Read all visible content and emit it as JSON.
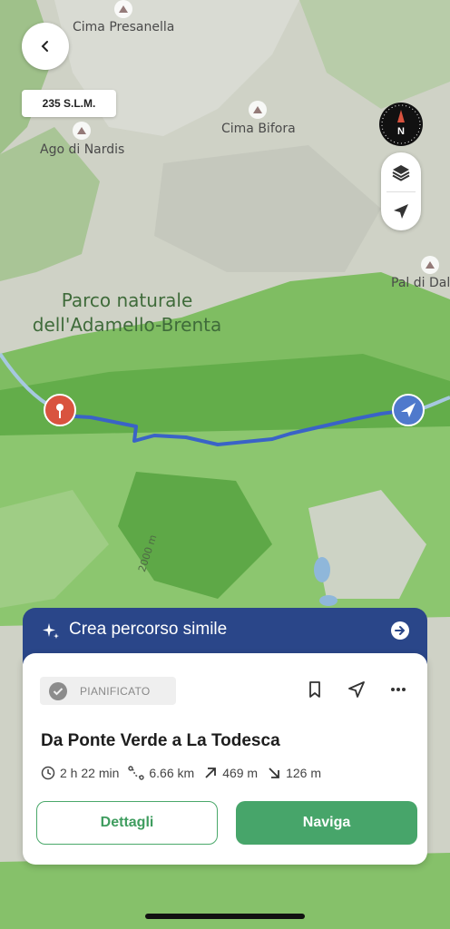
{
  "map": {
    "elevation_badge": "235 S.L.M.",
    "park_label": "Parco naturale dell'Adamello-Brenta",
    "contour_label": "2000 m",
    "peaks": [
      {
        "name": "Cima Presanella"
      },
      {
        "name": "Ago di Nardis"
      },
      {
        "name": "Cima Bifora"
      },
      {
        "name": "Pal di Dale"
      }
    ],
    "compass_letter": "N"
  },
  "banner": {
    "title": "Crea percorso simile"
  },
  "card": {
    "status": "PIANIFICATO",
    "route_title": "Da Ponte Verde a La Todesca",
    "stats": {
      "duration": "2 h 22 min",
      "distance": "6.66 km",
      "ascent": "469 m",
      "descent": "126 m"
    },
    "buttons": {
      "details": "Dettagli",
      "navigate": "Naviga"
    }
  },
  "colors": {
    "banner": "#2a4689",
    "primary_green": "#47a56a",
    "route_line": "#3a63c7",
    "start_marker": "#d9533f"
  }
}
